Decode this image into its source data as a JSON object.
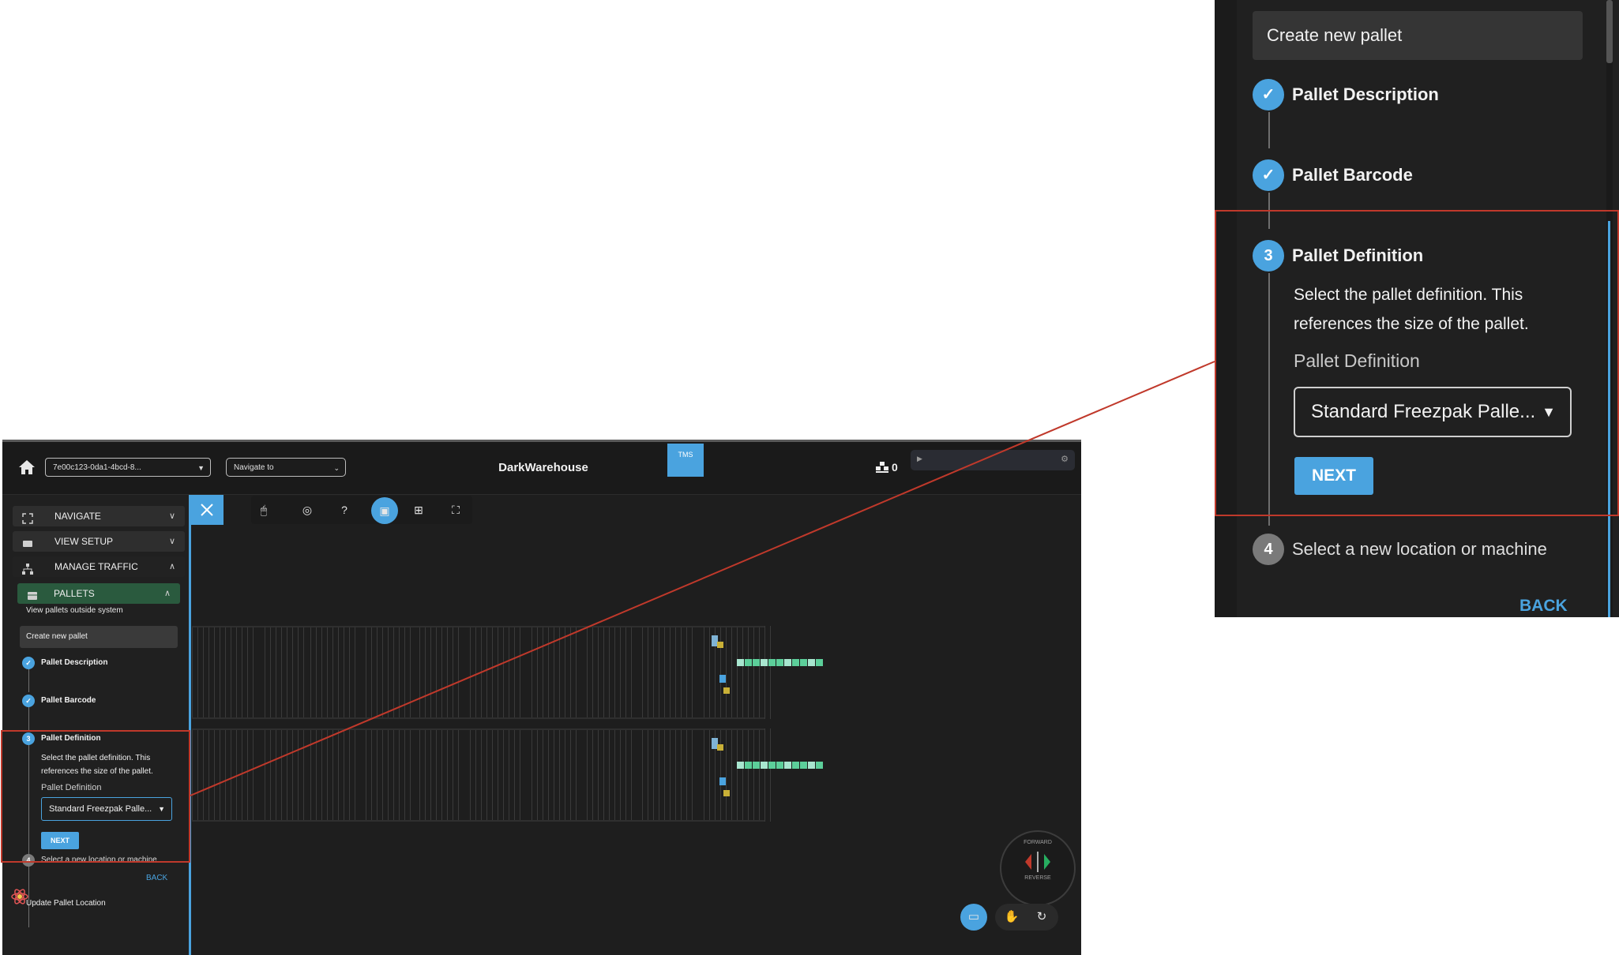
{
  "header": {
    "pallet_select_value": "7e00c123-0da1-4bcd-8...",
    "navigate_placeholder": "Navigate to",
    "app_title": "DarkWarehouse",
    "tms_tag": "TMS",
    "pallet_count": "0"
  },
  "sidebar": {
    "sections": [
      {
        "label": "NAVIGATE",
        "icon": "expand-icon",
        "expanded": false
      },
      {
        "label": "VIEW SETUP",
        "icon": "video-icon",
        "expanded": false
      },
      {
        "label": "MANAGE TRAFFIC",
        "icon": "sitemap-icon",
        "expanded": true
      }
    ],
    "pallets_label": "PALLETS",
    "view_outside_link": "View pallets outside system",
    "create_pallet_title": "Create new pallet",
    "steps": [
      {
        "number": "1",
        "label": "Pallet Description",
        "status": "done"
      },
      {
        "number": "2",
        "label": "Pallet Barcode",
        "status": "done"
      },
      {
        "number": "3",
        "label": "Pallet Definition",
        "status": "active"
      },
      {
        "number": "4",
        "label": "Select a new location or machine",
        "status": "todo"
      }
    ],
    "active_step": {
      "description": "Select the pallet definition. This references the size of the pallet.",
      "field_label": "Pallet Definition",
      "field_value": "Standard Freezpak Palle...",
      "next_label": "NEXT"
    },
    "back_label": "BACK",
    "update_location_label": "Update Pallet Location"
  },
  "view_controls": {
    "forward_label": "FORWARD",
    "reverse_label": "REVERSE"
  },
  "zoom_panel": {
    "create_pallet_title": "Create new pallet",
    "steps": [
      {
        "number": "1",
        "label": "Pallet Description",
        "status": "done"
      },
      {
        "number": "2",
        "label": "Pallet Barcode",
        "status": "done"
      },
      {
        "number": "3",
        "label": "Pallet Definition",
        "status": "active"
      },
      {
        "number": "4",
        "label": "Select a new location or machine",
        "status": "todo"
      }
    ],
    "description": "Select the pallet definition. This references the size of the pallet.",
    "field_label": "Pallet Definition",
    "field_value": "Standard Freezpak Palle...",
    "next_label": "NEXT",
    "back_label": "BACK"
  },
  "colors": {
    "accent": "#4aa3df",
    "highlight": "#c0392b",
    "pallets_active": "#2a5a3e",
    "background": "#1e1e1e"
  }
}
